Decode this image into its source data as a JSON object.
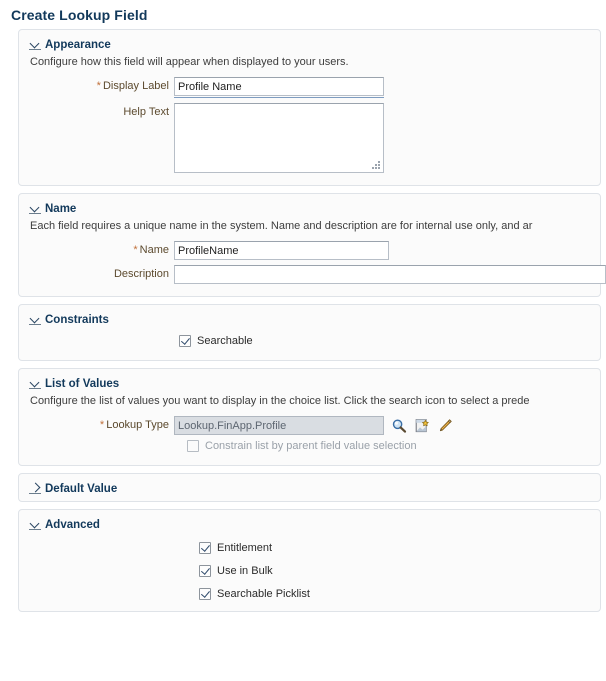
{
  "page": {
    "title": "Create Lookup Field"
  },
  "sections": {
    "appearance": {
      "title": "Appearance",
      "description": "Configure how this field will appear when displayed to your users.",
      "expanded": true,
      "display_label": {
        "label": "Display Label",
        "required": true,
        "value": "Profile Name",
        "placeholder": ""
      },
      "help_text": {
        "label": "Help Text",
        "required": false,
        "value": "",
        "placeholder": ""
      }
    },
    "name": {
      "title": "Name",
      "description": "Each field requires a unique name in the system. Name and description are for internal use only, and ar",
      "expanded": true,
      "name_field": {
        "label": "Name",
        "required": true,
        "value": "ProfileName",
        "placeholder": ""
      },
      "description_field": {
        "label": "Description",
        "required": false,
        "value": "",
        "placeholder": ""
      }
    },
    "constraints": {
      "title": "Constraints",
      "expanded": true,
      "searchable": {
        "label": "Searchable",
        "checked": true,
        "disabled": false
      }
    },
    "list_of_values": {
      "title": "List of Values",
      "description": "Configure the list of values you want to display in the choice list. Click the search icon to select a prede",
      "expanded": true,
      "lookup_type": {
        "label": "Lookup Type",
        "required": true,
        "value": "Lookup.FinApp.Profile",
        "disabled": true
      },
      "icons": {
        "search": "search-icon",
        "create": "create-lookup-icon",
        "edit": "edit-pencil-icon"
      },
      "constrain_list": {
        "label": "Constrain list by parent field value selection",
        "checked": false,
        "disabled": true
      }
    },
    "default_value": {
      "title": "Default Value",
      "expanded": false
    },
    "advanced": {
      "title": "Advanced",
      "expanded": true,
      "checkboxes": [
        {
          "label": "Entitlement",
          "checked": true,
          "disabled": false
        },
        {
          "label": "Use in Bulk",
          "checked": true,
          "disabled": false
        },
        {
          "label": "Searchable Picklist",
          "checked": true,
          "disabled": false
        }
      ]
    }
  },
  "colors": {
    "title_navy": "#12395b",
    "label_brown": "#5c4a2e",
    "required_asterisk": "#c0703a",
    "panel_border": "#dfe3e8",
    "panel_bg": "#fbfbfb",
    "accent_underline": "#7e9cc0",
    "disabled_field_bg": "#d9dde2"
  }
}
